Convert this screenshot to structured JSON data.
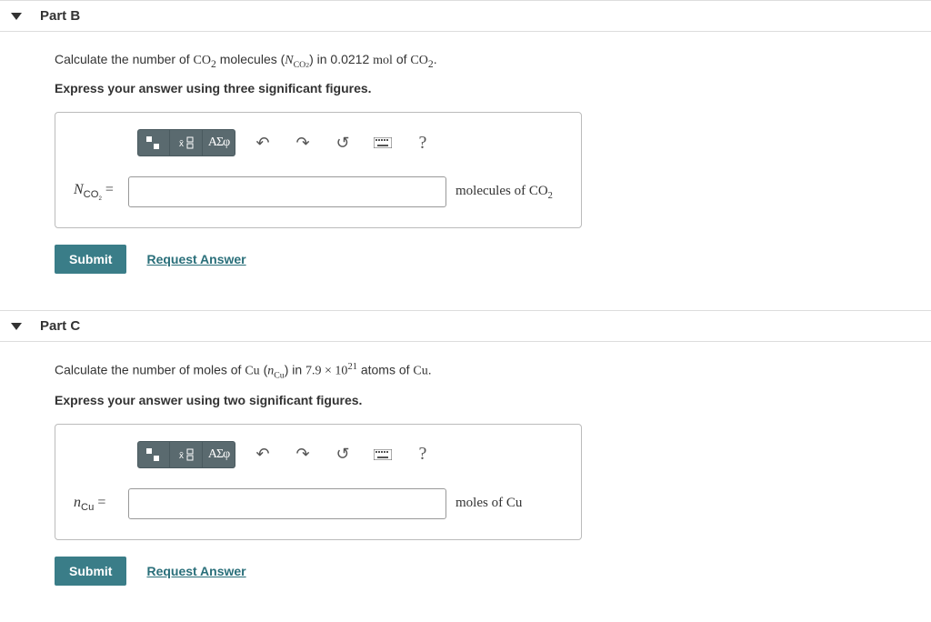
{
  "partB": {
    "title": "Part B",
    "prompt_pre": "Calculate the number of ",
    "prompt_mol": "CO",
    "prompt_molsub": "2",
    "prompt_mid": " molecules (",
    "prompt_var": "N",
    "prompt_varsub": "CO",
    "prompt_varsub2": "2",
    "prompt_post": ") in 0.0212 ",
    "prompt_unit": "mol",
    "prompt_of": " of ",
    "prompt_end": ".",
    "instruction": "Express your answer using three significant figures.",
    "var_main": "N",
    "var_sub": "CO",
    "var_sub2": "2",
    "equals": " =",
    "input_value": "",
    "unit_pre": "molecules of ",
    "unit_mol": "CO",
    "unit_sub": "2",
    "submit": "Submit",
    "request": "Request Answer",
    "greek": "ΑΣφ",
    "help": "?"
  },
  "partC": {
    "title": "Part C",
    "prompt_pre": "Calculate the number of moles of ",
    "prompt_el": "Cu",
    "prompt_open": " (",
    "prompt_var": "n",
    "prompt_varsub": "Cu",
    "prompt_mid": ") in ",
    "prompt_num": "7.9 × 10",
    "prompt_exp": "21",
    "prompt_post": " atoms of ",
    "prompt_end": ".",
    "instruction": "Express your answer using two significant figures.",
    "var_main": "n",
    "var_sub": "Cu",
    "equals": " =",
    "input_value": "",
    "unit_pre": "moles of ",
    "unit_el": "Cu",
    "submit": "Submit",
    "request": "Request Answer",
    "greek": "ΑΣφ",
    "help": "?"
  }
}
